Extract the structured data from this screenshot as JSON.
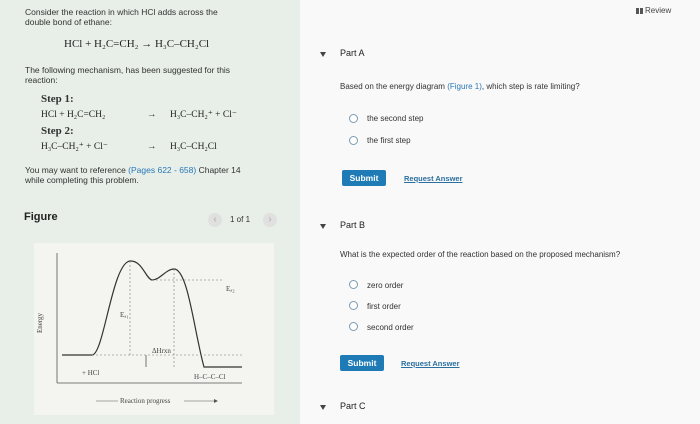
{
  "problem": {
    "intro_line1": "Consider the reaction in which HCl adds across the",
    "intro_line2": "double bond of ethane:",
    "reaction": "HCl + H₂C=CH₂ → H₃C–CH₂Cl",
    "mech_line1": "The following mechanism, has been suggested for this",
    "mech_line2": "reaction:",
    "step1_title": "Step 1:",
    "step1_left": "HCl + H₂C=CH₂",
    "step1_right": "H₃C–CH₂⁺ + Cl⁻",
    "step2_title": "Step 2:",
    "step2_left": "H₃C–CH₂⁺ + Cl⁻",
    "step2_right": "H₃C–CH₂Cl",
    "arrow": "→",
    "ref_prefix": "You may want to reference ",
    "ref_link": "(Pages 622 - 658)",
    "ref_suffix": " Chapter 14",
    "ref_line2": "while completing this problem."
  },
  "figure": {
    "title": "Figure",
    "pager": "1 of 1",
    "prev": "‹",
    "next": "›",
    "y_label": "Energy",
    "x_label": "Reaction progress",
    "ea1": "Eₐ₁",
    "ea2": "Eₐ₂",
    "dh": "ΔHrxn",
    "reactants": "+ HCl",
    "product": "H–C–C–Cl"
  },
  "header": {
    "review": "Review"
  },
  "partA": {
    "label": "Part A",
    "q_prefix": "Based on the energy diagram ",
    "q_link": "(Figure 1)",
    "q_suffix": ", which step is rate limiting?",
    "options": [
      "the second step",
      "the first step"
    ],
    "submit": "Submit",
    "request": "Request Answer"
  },
  "partB": {
    "label": "Part B",
    "question": "What is the expected order of the reaction based on the proposed mechanism?",
    "options": [
      "zero order",
      "first order",
      "second order"
    ],
    "submit": "Submit",
    "request": "Request Answer"
  },
  "partC": {
    "label": "Part C"
  },
  "colors": {
    "left_bg": "#e7efe8",
    "submit": "#1f7bb6",
    "link": "#2a78b7"
  }
}
